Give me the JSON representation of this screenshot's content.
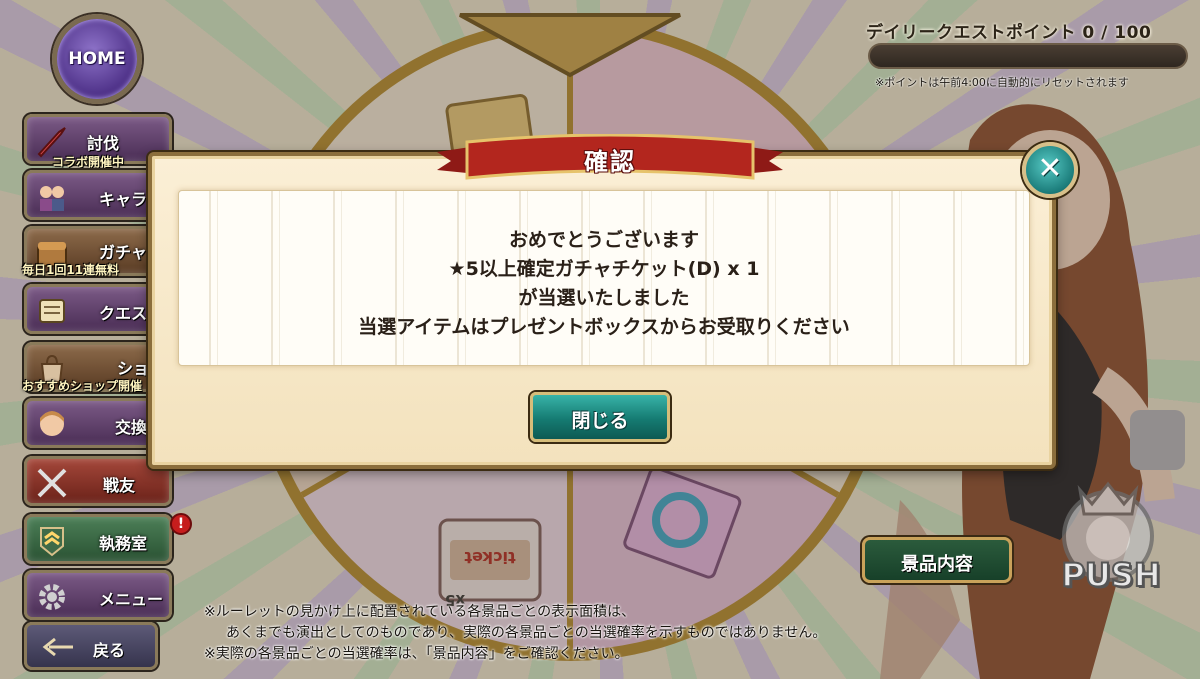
{
  "home": {
    "label": "HOME"
  },
  "daily": {
    "title": "デイリークエストポイント 0 / 100",
    "progress_fraction": 0,
    "note": "※ポイントは午前4:00に自動的にリセットされます"
  },
  "nav": {
    "items": [
      {
        "label": "討伐",
        "sub": "コラボ開催中"
      },
      {
        "label": "キャラ"
      },
      {
        "label": "ガチャ",
        "sub": "毎日1回11連無料"
      },
      {
        "label": "クエスト"
      },
      {
        "label": "ショップ",
        "sub": "おすすめショップ開催"
      },
      {
        "label": "交換所"
      },
      {
        "label": "戦友"
      },
      {
        "label": "執務室",
        "badge": "!"
      },
      {
        "label": "メニュー"
      }
    ],
    "back_label": "戻る"
  },
  "dialog": {
    "title": "確認",
    "close_symbol": "✕",
    "lines": [
      "おめでとうございます",
      "★5以上確定ガチャチケット(D) x 1",
      "が当選いたしました",
      "当選アイテムはプレゼントボックスからお受取りください"
    ],
    "ok_label": "閉じる"
  },
  "roulette": {
    "item_count_label": "x5",
    "ticket_label": "ticket"
  },
  "prize_button": {
    "label": "景品内容"
  },
  "push_button": {
    "label": "PUSH"
  },
  "disclaimer": {
    "line1": "※ルーレットの見かけ上に配置されている各景品ごとの表示面積は、",
    "line2": "あくまでも演出としてのものであり、実際の各景品ごとの当選確率を示すものではありません。",
    "line3": "※実際の各景品ごとの当選確率は、「景品内容」をご確認ください。"
  },
  "colors": {
    "accent_teal": "#157b72",
    "ribbon_red": "#b3261e",
    "dialog_frame": "#8b6e3c"
  }
}
